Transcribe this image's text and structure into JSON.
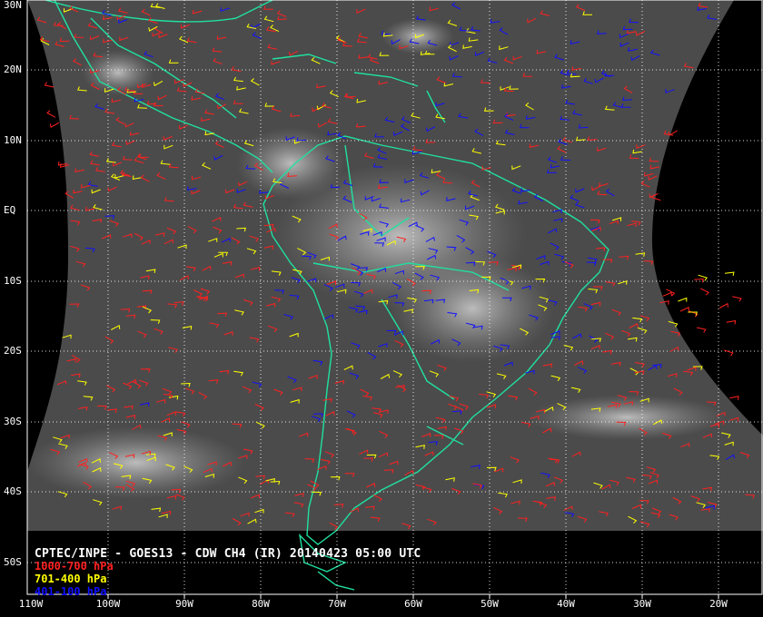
{
  "map": {
    "caption": "CPTEC/INPE - GOES13 - CDW CH4 (IR) 20140423 05:00 UTC",
    "legend": [
      {
        "label": "1000-700 hPa",
        "color": "#ff2020"
      },
      {
        "label": "701-400 hPa",
        "color": "#ffff00"
      },
      {
        "label": "401-100 hPa",
        "color": "#1010ff"
      }
    ],
    "lat_labels": [
      "30N",
      "20N",
      "10N",
      "EQ",
      "10S",
      "20S",
      "30S",
      "40S",
      "50S"
    ],
    "lon_labels": [
      "110W",
      "100W",
      "90W",
      "80W",
      "70W",
      "60W",
      "50W",
      "40W",
      "30W",
      "20W"
    ],
    "colors": {
      "background": "#000000",
      "coastline": "#20e0a0",
      "grid": "#ffffff",
      "cloud_gray": "#4a4a4a"
    }
  }
}
